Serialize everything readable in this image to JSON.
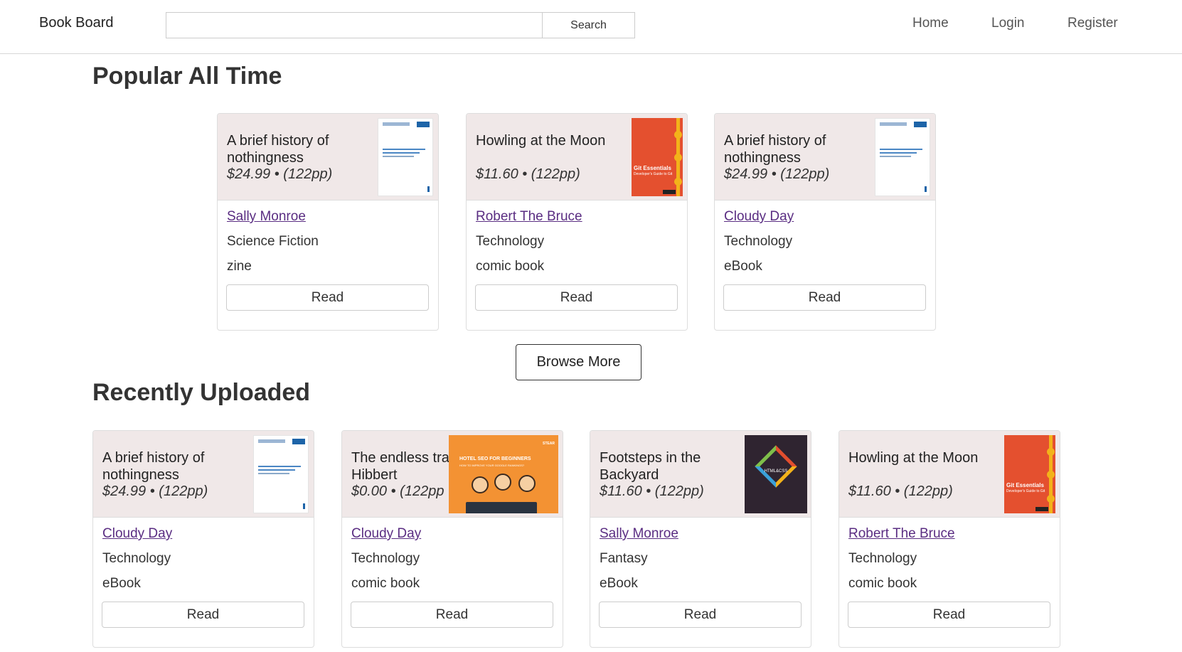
{
  "nav": {
    "brand": "Book Board",
    "search_placeholder": "",
    "search_button": "Search",
    "links": [
      "Home",
      "Login",
      "Register"
    ]
  },
  "popular": {
    "title": "Popular All Time",
    "cards": [
      {
        "title": "A brief history of nothingness",
        "price": "$24.99 • (122pp)",
        "author": "Sally Monroe",
        "genre": "Science Fiction",
        "format": "zine",
        "read": "Read",
        "cover": "document-cover"
      },
      {
        "title": "Howling at the Moon",
        "price": "$11.60 • (122pp)",
        "author": "Robert The Bruce",
        "genre": "Technology",
        "format": "comic book",
        "read": "Read",
        "cover": "git-essentials-cover"
      },
      {
        "title": "A brief history of nothingness",
        "price": "$24.99 • (122pp)",
        "author": "Cloudy Day",
        "genre": "Technology",
        "format": "eBook",
        "read": "Read",
        "cover": "document-cover"
      }
    ]
  },
  "browse_more": "Browse More",
  "recent": {
    "title": "Recently Uploaded",
    "cards": [
      {
        "title": "A brief history of nothingness",
        "price": "$24.99 • (122pp)",
        "author": "Cloudy Day",
        "genre": "Technology",
        "format": "eBook",
        "read": "Read",
        "cover": "document-cover"
      },
      {
        "title": "The endless tra of Hibbert",
        "price": "$0.00 • (122pp",
        "author": "Cloudy Day",
        "genre": "Technology",
        "format": "comic book",
        "read": "Read",
        "cover": "hotel-seo-cover"
      },
      {
        "title": "Footsteps in the Backyard",
        "price": "$11.60 • (122pp)",
        "author": "Sally Monroe",
        "genre": "Fantasy",
        "format": "eBook",
        "read": "Read",
        "cover": "html-css-cover"
      },
      {
        "title": "Howling at the Moon",
        "price": "$11.60 • (122pp)",
        "author": "Robert The Bruce",
        "genre": "Technology",
        "format": "comic book",
        "read": "Read",
        "cover": "git-essentials-cover"
      }
    ]
  },
  "cover_text": {
    "git_title": "Git Essentials",
    "git_subtitle": "Developer's Guide to Git",
    "seo_title": "HOTEL SEO FOR BEGINNERS",
    "seo_subtitle": "HOW TO IMPROVE YOUR GOOGLE RANKINGS?",
    "seo_brand": "STEAR",
    "html_label": "HTML&CSS"
  },
  "colors": {
    "card_header": "#f0e8e8",
    "link": "#5a2d82",
    "border": "#dddddd"
  }
}
